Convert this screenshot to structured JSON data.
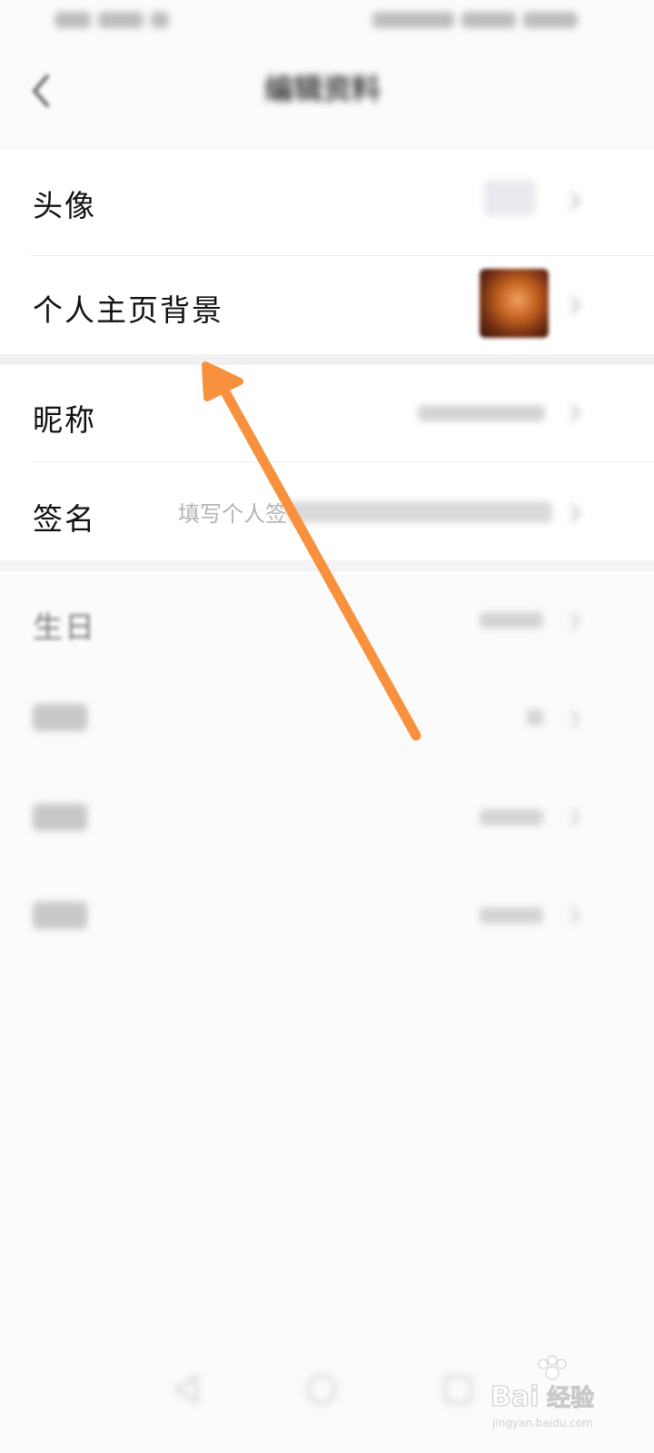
{
  "header": {
    "title": "编辑资料"
  },
  "rows": {
    "avatar": {
      "label": "头像"
    },
    "background": {
      "label": "个人主页背景"
    },
    "nickname": {
      "label": "昵称"
    },
    "signature": {
      "label": "签名",
      "placeholder": "填写个人签"
    },
    "birthday": {
      "label": "生日"
    }
  },
  "watermark": {
    "text": "Bai",
    "text2": "经验",
    "sub": "jingyan.baidu.com"
  },
  "colors": {
    "arrow": "#f7913d",
    "background": "#fbfbfb"
  }
}
